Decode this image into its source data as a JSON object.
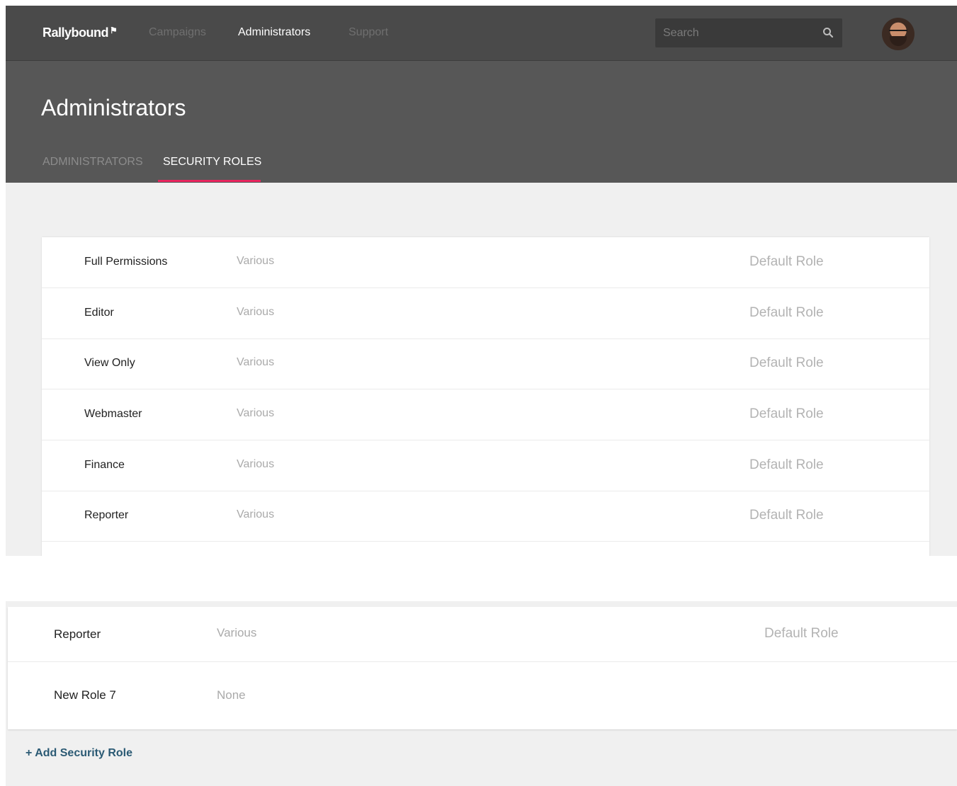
{
  "nav": {
    "logo": "Rallybound",
    "logo_flag": "⚑",
    "items": [
      {
        "label": "Campaigns"
      },
      {
        "label": "Administrators"
      },
      {
        "label": "Support"
      }
    ]
  },
  "search": {
    "placeholder": "Search",
    "value": ""
  },
  "header": {
    "title": "Administrators",
    "tabs": [
      {
        "label": "ADMINISTRATORS"
      },
      {
        "label": "SECURITY ROLES"
      }
    ],
    "active_tab": "SECURITY ROLES"
  },
  "roles_top": [
    {
      "name": "Full Permissions",
      "permissions": "Various",
      "type": "Default Role"
    },
    {
      "name": "Editor",
      "permissions": "Various",
      "type": "Default Role"
    },
    {
      "name": "View Only",
      "permissions": "Various",
      "type": "Default Role"
    },
    {
      "name": "Webmaster",
      "permissions": "Various",
      "type": "Default Role"
    },
    {
      "name": "Finance",
      "permissions": "Various",
      "type": "Default Role"
    },
    {
      "name": "Reporter",
      "permissions": "Various",
      "type": "Default Role"
    }
  ],
  "roles_bottom": [
    {
      "name": "Reporter",
      "permissions": "Various",
      "type": "Default Role"
    },
    {
      "name": "New Role 7",
      "permissions": "None",
      "type": ""
    }
  ],
  "add_link": "+ Add Security Role",
  "colors": {
    "topbar": "#4a4a4a",
    "header": "#575757",
    "accent_underline": "#e8255e",
    "link": "#2b5a74",
    "page_background": "#f0f0f0"
  },
  "icons": {
    "search": "search-icon",
    "user": "avatar"
  }
}
